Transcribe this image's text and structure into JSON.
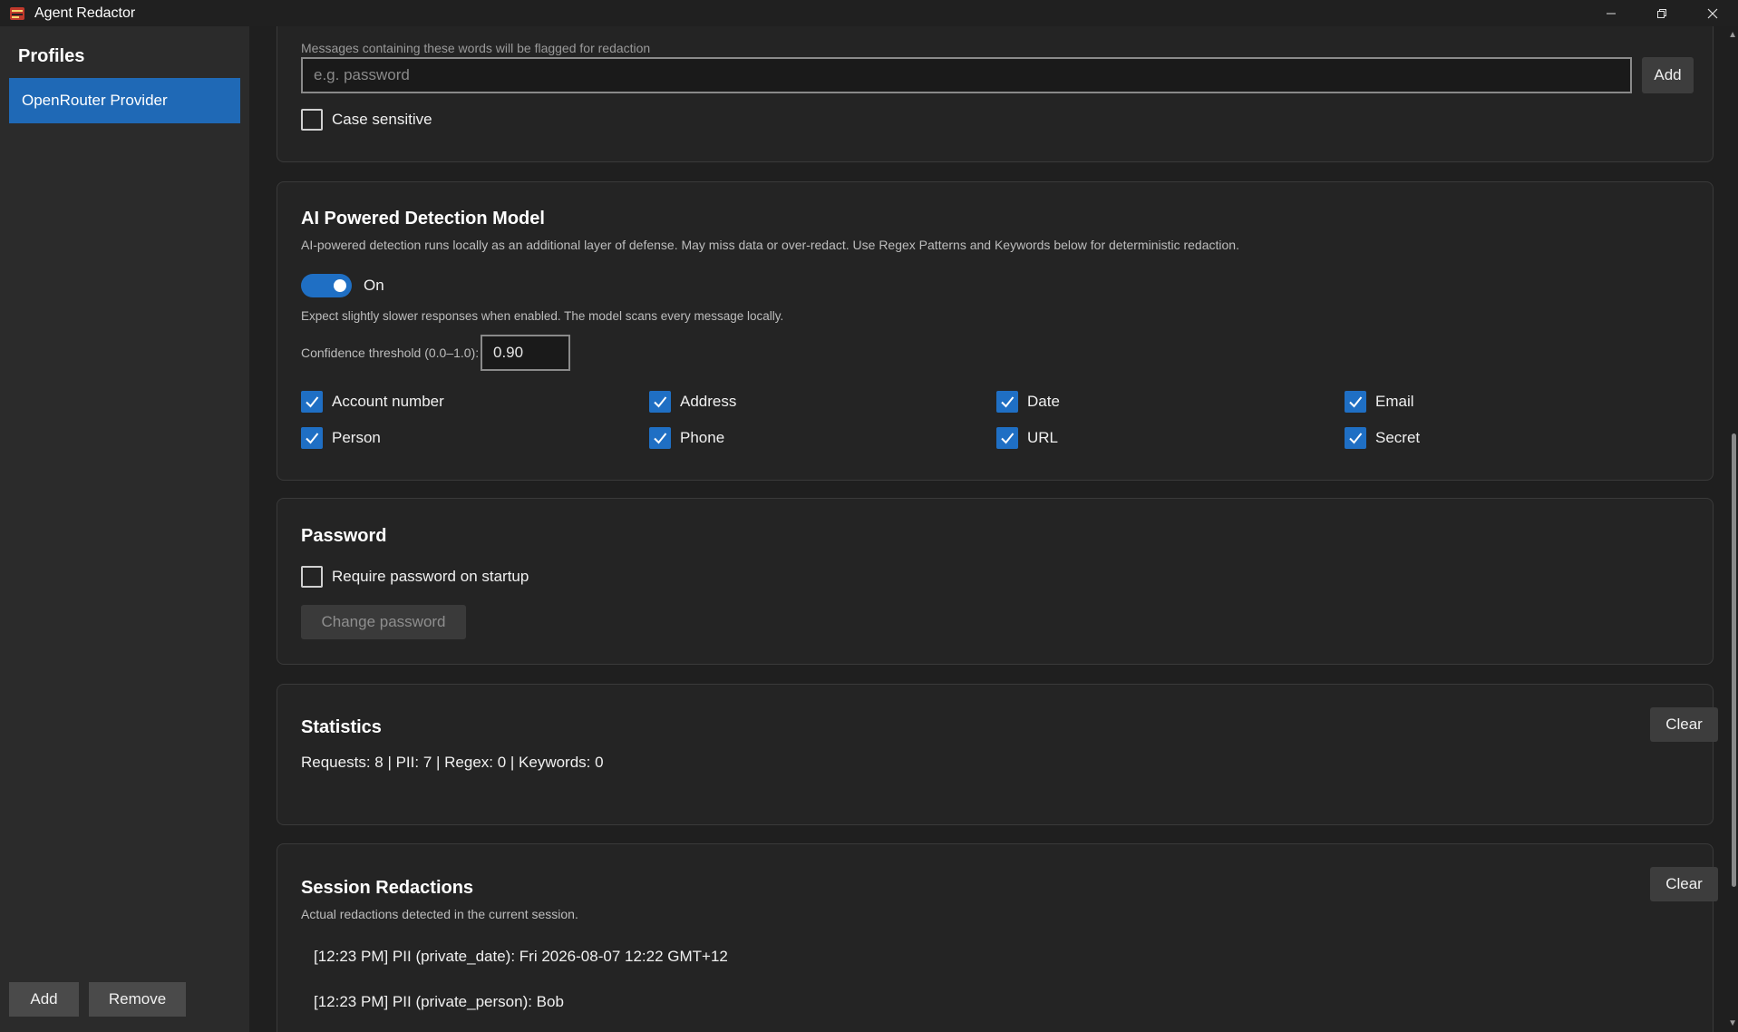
{
  "window": {
    "title": "Agent Redactor"
  },
  "sidebar": {
    "heading": "Profiles",
    "profiles": [
      {
        "label": "OpenRouter Provider",
        "selected": true
      }
    ],
    "add_label": "Add",
    "remove_label": "Remove"
  },
  "keywords": {
    "description": "Messages containing these words will be flagged for redaction",
    "input_placeholder": "e.g. password",
    "input_value": "",
    "add_label": "Add",
    "case_sensitive_label": "Case sensitive",
    "case_sensitive_checked": false
  },
  "ai_detection": {
    "title": "AI Powered Detection Model",
    "description": "AI-powered detection runs locally as an additional layer of defense. May miss data or over-redact. Use Regex Patterns and Keywords below for deterministic redaction.",
    "toggle_label": "On",
    "toggle_on": true,
    "note": "Expect slightly slower responses when enabled. The model scans every message locally.",
    "threshold_label": "Confidence threshold (0.0–1.0):",
    "threshold_value": "0.90",
    "categories": [
      {
        "label": "Account number",
        "checked": true
      },
      {
        "label": "Address",
        "checked": true
      },
      {
        "label": "Date",
        "checked": true
      },
      {
        "label": "Email",
        "checked": true
      },
      {
        "label": "Person",
        "checked": true
      },
      {
        "label": "Phone",
        "checked": true
      },
      {
        "label": "URL",
        "checked": true
      },
      {
        "label": "Secret",
        "checked": true
      }
    ]
  },
  "password": {
    "title": "Password",
    "require_label": "Require password on startup",
    "require_checked": false,
    "change_label": "Change password"
  },
  "statistics": {
    "title": "Statistics",
    "clear_label": "Clear",
    "summary": "Requests: 8  |  PII: 7  |  Regex: 0  |  Keywords: 0"
  },
  "session": {
    "title": "Session Redactions",
    "clear_label": "Clear",
    "description": "Actual redactions detected in the current session.",
    "entries": [
      "[12:23 PM] PII (private_date): Fri 2026-08-07 12:22 GMT+12",
      "[12:23 PM] PII (private_person): Bob"
    ]
  },
  "colors": {
    "accent": "#1f6fc4",
    "selected_profile": "#1f69b6",
    "background": "#1f1f1f",
    "sidebar": "#2b2b2b"
  }
}
